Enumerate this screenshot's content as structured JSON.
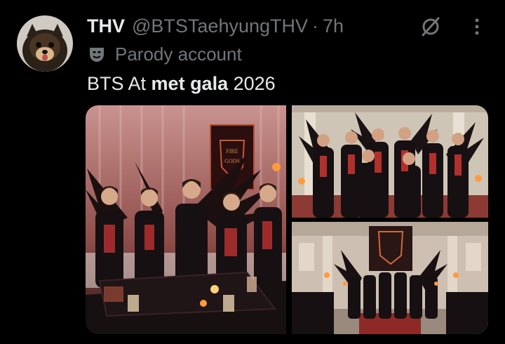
{
  "author": {
    "display_name": "THV",
    "handle": "@BTSTaehyungTHV",
    "separator": "·",
    "time": "7h",
    "label": "Parody account"
  },
  "tweet": {
    "text_before": "BTS At ",
    "text_bold": "met gala",
    "text_after": " 2026"
  },
  "media": {
    "sign_text_line1": "FIRE",
    "sign_text_line2": "GODS"
  },
  "icons": {
    "grok": "grok-icon",
    "more": "more-vertical-icon",
    "parody": "theater-mask-icon"
  },
  "colors": {
    "background": "#000000",
    "text": "#e7e9ea",
    "secondary": "#71767b"
  }
}
